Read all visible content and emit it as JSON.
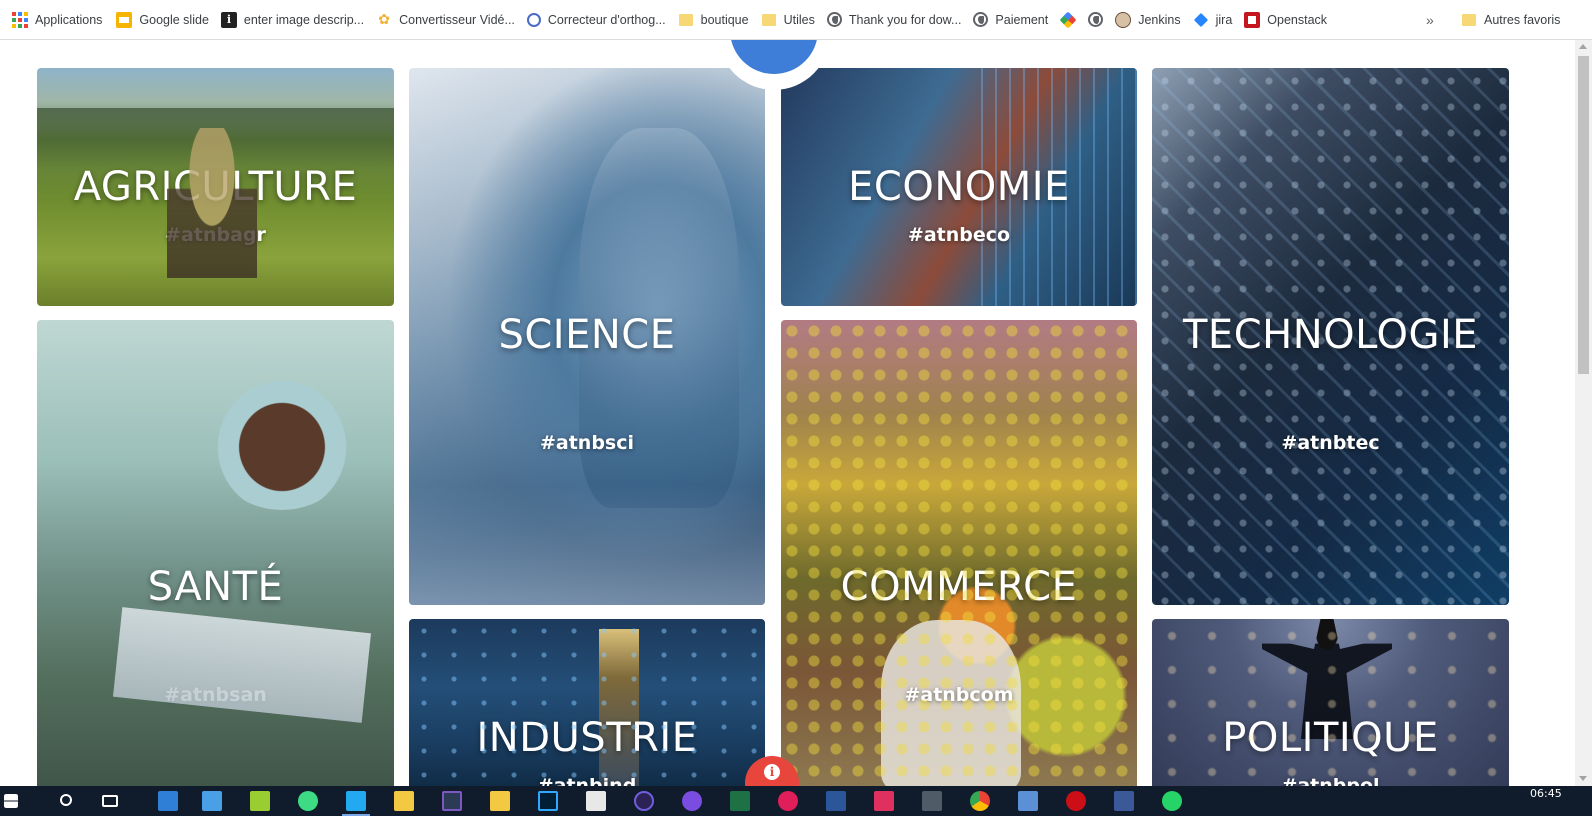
{
  "bookmarks": {
    "items": [
      {
        "label": "Applications",
        "icon": "apps-grid-icon"
      },
      {
        "label": "Google slide",
        "icon": "google-slides-icon"
      },
      {
        "label": "enter image descrip...",
        "icon": "stackoverflow-icon"
      },
      {
        "label": "Convertisseur Vidé...",
        "icon": "converter-icon"
      },
      {
        "label": "Correcteur d'orthog...",
        "icon": "spellcheck-icon"
      },
      {
        "label": "boutique",
        "icon": "folder-icon"
      },
      {
        "label": "Utiles",
        "icon": "folder-icon"
      },
      {
        "label": "Thank you for dow...",
        "icon": "globe-icon"
      },
      {
        "label": "Paiement",
        "icon": "globe-icon"
      },
      {
        "label": "",
        "icon": "pinwheel-icon"
      },
      {
        "label": "",
        "icon": "globe-icon"
      },
      {
        "label": "Jenkins",
        "icon": "jenkins-icon"
      },
      {
        "label": "jira",
        "icon": "jira-icon"
      },
      {
        "label": "Openstack",
        "icon": "openstack-icon"
      }
    ],
    "more": "»",
    "other_favorites": "Autres favoris"
  },
  "tiles": {
    "agriculture": {
      "title": "AGRICULTURE",
      "tag": "#atnbagr"
    },
    "science": {
      "title": "SCIENCE",
      "tag": "#atnbsci"
    },
    "economie": {
      "title": "ECONOMIE",
      "tag": "#atnbeco"
    },
    "technologie": {
      "title": "TECHNOLOGIE",
      "tag": "#atnbtec"
    },
    "sante": {
      "title": "SANTÉ",
      "tag": "#atnbsan"
    },
    "commerce": {
      "title": "COMMERCE",
      "tag": "#atnbcom"
    },
    "industrie": {
      "title": "INDUSTRIE",
      "tag": "#atnbind"
    },
    "politique": {
      "title": "POLITIQUE",
      "tag": "#atnbpol"
    }
  },
  "info_button": {
    "glyph": "i"
  },
  "colors": {
    "accent_blue": "#3f7ed8",
    "info_red": "#e8453c",
    "taskbar": "#101b2b"
  },
  "taskbar": {
    "apps": [
      "windows-start-icon",
      "search-icon",
      "task-view-icon",
      "photos-icon",
      "snipping-icon",
      "notepadpp-icon",
      "android-studio-icon",
      "vscode-icon",
      "file-explorer-icon",
      "folder-icon",
      "sticky-notes-icon",
      "photoshop-icon",
      "paint-icon",
      "eclipse-icon",
      "github-icon",
      "excel-icon",
      "slack-icon",
      "word-icon",
      "intellij-icon",
      "git-icon",
      "chrome-icon",
      "network-icon",
      "opera-icon",
      "facebook-icon",
      "whatsapp-icon"
    ],
    "clock": "06:45"
  }
}
